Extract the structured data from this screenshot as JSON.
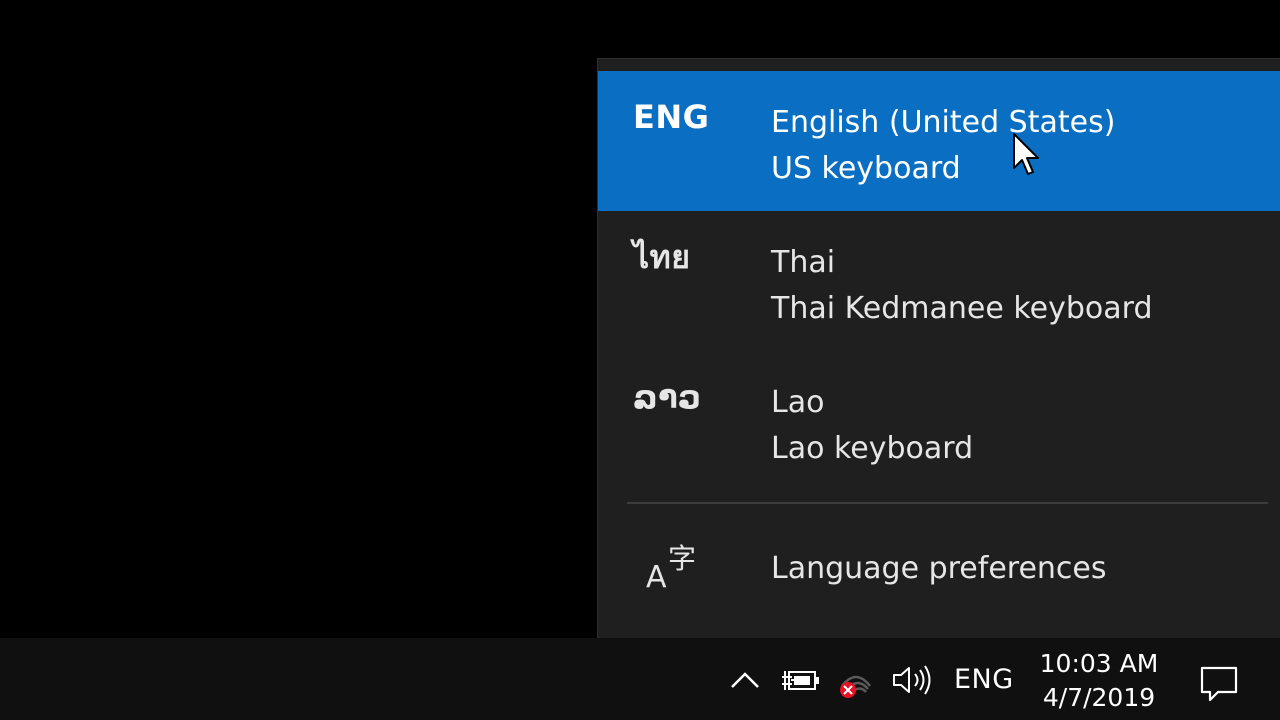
{
  "flyout": {
    "languages": [
      {
        "abbr": "ENG",
        "name": "English (United States)",
        "keyboard": "US keyboard",
        "selected": true
      },
      {
        "abbr": "ไทย",
        "name": "Thai",
        "keyboard": "Thai Kedmanee keyboard",
        "selected": false
      },
      {
        "abbr": "ລາວ",
        "name": "Lao",
        "keyboard": "Lao keyboard",
        "selected": false
      }
    ],
    "preferences": {
      "icon": "language-preferences-icon",
      "icon_glyph_a": "A",
      "icon_glyph_char": "字",
      "label": "Language preferences"
    },
    "selected_color": "#0a6fc2",
    "background_color": "#1f1f1f"
  },
  "taskbar": {
    "tray_icons": [
      "chevron-up-icon",
      "battery-charging-icon",
      "wifi-disconnected-icon",
      "volume-icon"
    ],
    "input_indicator": "ENG",
    "clock": {
      "time": "10:03 AM",
      "date": "4/7/2019"
    },
    "action_center_icon": "action-center-icon",
    "background_color": "#101010"
  }
}
